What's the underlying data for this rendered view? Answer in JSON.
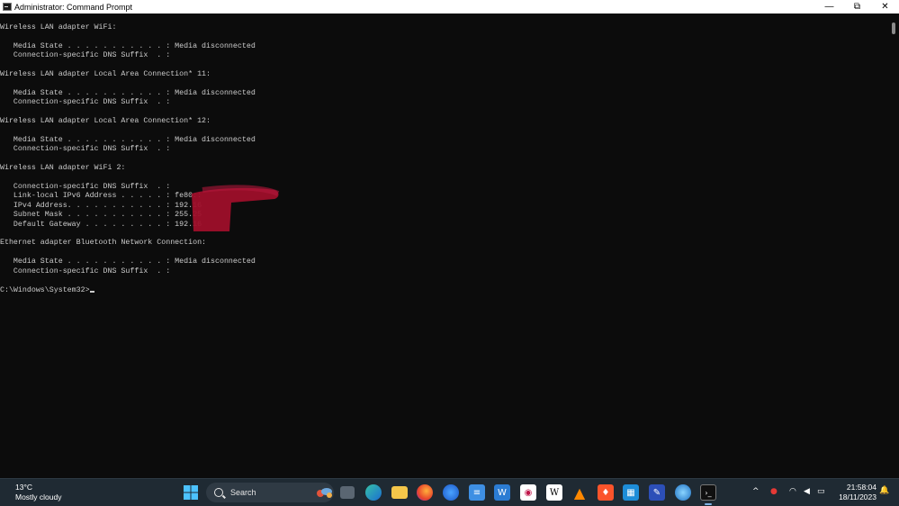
{
  "window": {
    "title": "Administrator: Command Prompt",
    "controls": {
      "minimize": "—",
      "maximize": "⧉",
      "close": "✕"
    }
  },
  "console": {
    "lines": [
      "Wireless LAN adapter WiFi:",
      "",
      "   Media State . . . . . . . . . . . : Media disconnected",
      "   Connection-specific DNS Suffix  . :",
      "",
      "Wireless LAN adapter Local Area Connection* 11:",
      "",
      "   Media State . . . . . . . . . . . : Media disconnected",
      "   Connection-specific DNS Suffix  . :",
      "",
      "Wireless LAN adapter Local Area Connection* 12:",
      "",
      "   Media State . . . . . . . . . . . : Media disconnected",
      "   Connection-specific DNS Suffix  . :",
      "",
      "Wireless LAN adapter WiFi 2:",
      "",
      "   Connection-specific DNS Suffix  . :",
      "   Link-local IPv6 Address . . . . . : fe80::",
      "   IPv4 Address. . . . . . . . . . . : 192.16",
      "   Subnet Mask . . . . . . . . . . . : 255.25",
      "   Default Gateway . . . . . . . . . : 192.16",
      "",
      "Ethernet adapter Bluetooth Network Connection:",
      "",
      "   Media State . . . . . . . . . . . : Media disconnected",
      "   Connection-specific DNS Suffix  . :",
      "",
      "C:\\Windows\\System32>"
    ],
    "redaction_color": "#9e0f2a"
  },
  "taskbar": {
    "weather": {
      "temp": "13°C",
      "condition": "Mostly cloudy"
    },
    "search_label": "Search",
    "start_icon": "windows-start-icon",
    "apps": [
      "widget-icon",
      "task-view-icon",
      "edge-icon",
      "file-explorer-icon",
      "firefox-icon",
      "thunderbird-icon",
      "notepad-icon",
      "word-icon",
      "app-icon",
      "wikipedia-icon",
      "vlc-icon",
      "brave-icon",
      "excel-icon",
      "image-editor-icon",
      "browser-icon",
      "terminal-icon"
    ],
    "tray": {
      "chevron": "^",
      "date": "18/11/2023",
      "time": "21:58:04"
    }
  }
}
